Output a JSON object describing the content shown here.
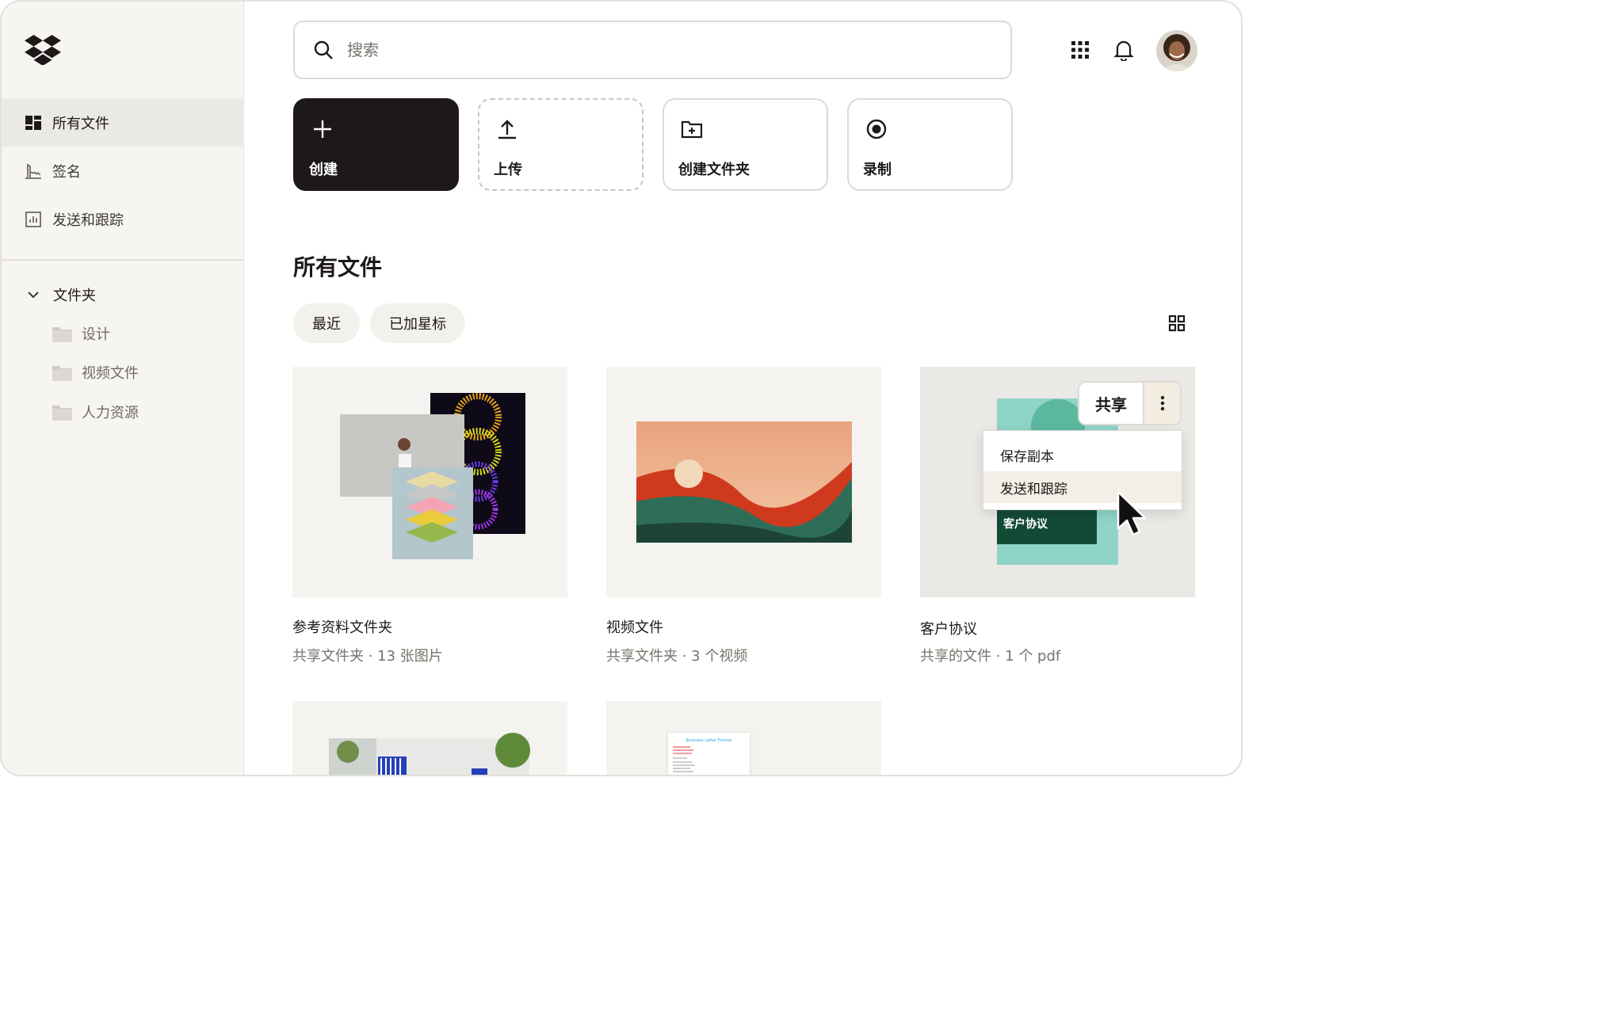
{
  "sidebar": {
    "nav": [
      {
        "label": "所有文件",
        "icon": "all-files-icon",
        "active": true
      },
      {
        "label": "签名",
        "icon": "signature-icon",
        "active": false
      },
      {
        "label": "发送和跟踪",
        "icon": "send-track-icon",
        "active": false
      }
    ],
    "folders_heading": "文件夹",
    "folders": [
      {
        "label": "设计"
      },
      {
        "label": "视频文件"
      },
      {
        "label": "人力资源"
      }
    ]
  },
  "header": {
    "search_placeholder": "搜索",
    "icons": [
      "apps-grid-icon",
      "bell-icon"
    ]
  },
  "actions": [
    {
      "label": "创建",
      "icon": "plus-icon"
    },
    {
      "label": "上传",
      "icon": "upload-icon"
    },
    {
      "label": "创建文件夹",
      "icon": "folder-plus-icon"
    },
    {
      "label": "录制",
      "icon": "record-icon"
    }
  ],
  "main": {
    "title": "所有文件",
    "filters": [
      "最近",
      "已加星标"
    ],
    "files": [
      {
        "name": "参考资料文件夹",
        "meta": "共享文件夹 · 13 张图片"
      },
      {
        "name": "视频文件",
        "meta": "共享文件夹 · 3 个视频"
      },
      {
        "name": "客户协议",
        "meta": "共享的文件 · 1 个 pdf"
      }
    ],
    "card_label": "客户协议",
    "doc_title": "Business Letter Format"
  },
  "share": {
    "button": "共享",
    "menu": [
      "保存副本",
      "发送和跟踪"
    ]
  },
  "colors": {
    "sidebar_bg": "#f7f5f2",
    "primary_dark": "#1e1919",
    "muted_text": "#77726b",
    "menu_hover": "#f3efe6"
  }
}
